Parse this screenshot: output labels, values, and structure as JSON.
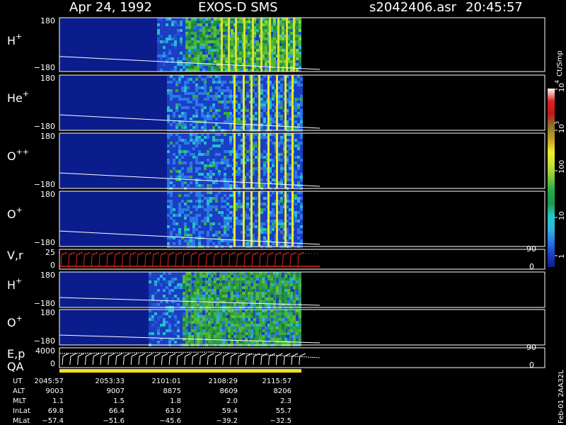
{
  "header": {
    "date": "Apr 24, 1992",
    "mission": "EXOS-D SMS",
    "file": "s2042406.asr",
    "time": "20:45:57"
  },
  "colorbar": {
    "unit": "Ct/Smp",
    "labels": [
      "1",
      "10",
      "100",
      "10",
      "10"
    ],
    "exponents": [
      "",
      "",
      "",
      "3",
      "4"
    ],
    "stops": [
      "#0b1d8c",
      "#1b3fc4",
      "#2b77e8",
      "#2fb7e0",
      "#22c8c8",
      "#1e9a48",
      "#2aa84a",
      "#7fc83a",
      "#c8e03a",
      "#f0f02a",
      "#c8a028",
      "#8a7a30",
      "#c01818",
      "#e02020",
      "#ffffff"
    ]
  },
  "panels": [
    {
      "base": "H",
      "sup": "+",
      "top": "180",
      "bottom": "−180"
    },
    {
      "base": "He",
      "sup": "+",
      "top": "180",
      "bottom": "−180"
    },
    {
      "base": "O",
      "sup": "++",
      "top": "180",
      "bottom": "−180"
    },
    {
      "base": "O",
      "sup": "+",
      "top": "180",
      "bottom": "−180"
    },
    {
      "base": "V,r",
      "sup": "",
      "top": "25",
      "bottom": "0",
      "right_top": "90",
      "right_bottom": "0"
    },
    {
      "base": "H",
      "sup": "+",
      "top": "180",
      "bottom": "−180"
    },
    {
      "base": "O",
      "sup": "+",
      "top": "180",
      "bottom": "−180"
    },
    {
      "base": "E,p",
      "sup": "",
      "top": "4000",
      "bottom": "0",
      "right_top": "90",
      "right_bottom": "0"
    }
  ],
  "qa_label": "QA",
  "side_note": "Feb-01 2AA32L",
  "ephemeris": {
    "row_labels": [
      "UT",
      "ALT",
      "MLT",
      "InLat",
      "MLat"
    ],
    "columns": [
      [
        "2045:57",
        "9003",
        "1.1",
        "69.8",
        "−57.4"
      ],
      [
        "2053:33",
        "9007",
        "1.5",
        "66.4",
        "−51.6"
      ],
      [
        "2101:01",
        "8875",
        "1.8",
        "63.0",
        "−45.6"
      ],
      [
        "2108:29",
        "8609",
        "2.0",
        "59.4",
        "−39.2"
      ],
      [
        "2115:57",
        "8206",
        "2.3",
        "55.7",
        "−32.5"
      ]
    ]
  },
  "chart_data": {
    "type": "heatmap",
    "title": "Apr 24, 1992    EXOS-D SMS",
    "x_ticks_ut": [
      "2045:57",
      "2053:33",
      "2101:01",
      "2108:29",
      "2115:57"
    ],
    "panels": [
      {
        "name": "H+",
        "ylim": [
          -180,
          180
        ]
      },
      {
        "name": "He+",
        "ylim": [
          -180,
          180
        ]
      },
      {
        "name": "O++",
        "ylim": [
          -180,
          180
        ]
      },
      {
        "name": "O+",
        "ylim": [
          -180,
          180
        ]
      },
      {
        "name": "V,r",
        "ylim": [
          0,
          25
        ],
        "right_ylim": [
          0,
          90
        ]
      },
      {
        "name": "H+",
        "ylim": [
          -180,
          180
        ]
      },
      {
        "name": "O+",
        "ylim": [
          -180,
          180
        ]
      },
      {
        "name": "E,p",
        "ylim": [
          0,
          4000
        ],
        "right_ylim": [
          0,
          90
        ]
      }
    ],
    "colorbar_unit": "Ct/Smp",
    "colorbar_ticks": [
      "1",
      "10",
      "100",
      "10^3",
      "10^4"
    ],
    "ut_range": [
      "2045:57",
      "2115:57"
    ]
  }
}
